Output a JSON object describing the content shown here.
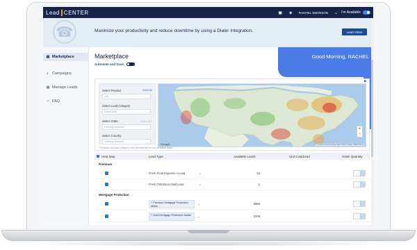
{
  "brand": {
    "logo_left": "Lead",
    "logo_right": "CENTER"
  },
  "topbar": {
    "user": "RACHEL SWANSON",
    "availability": "I'm Available"
  },
  "banner": {
    "message": "Maximize your productivity and reduce downtime by using a Dialer Integration.",
    "cta": "Learn More",
    "slide_count": 3,
    "active_slide": 3
  },
  "sidebar": {
    "items": [
      {
        "label": "Marketplace",
        "icon": "storefront-icon",
        "active": true
      },
      {
        "label": "Campaigns",
        "icon": "campaign-icon",
        "active": false
      },
      {
        "label": "Manage Leads",
        "icon": "leads-icon",
        "active": false
      },
      {
        "label": "FAQ",
        "icon": "faq-icon",
        "active": false
      }
    ]
  },
  "main": {
    "title": "Marketplace",
    "automate_label": "Automate and Save:",
    "greeting": "Good Morning, RACHEL"
  },
  "filters": {
    "product_label": "Select Product",
    "clear_all": "Clear All",
    "product_value": "Life",
    "category_label": "Select Lead Category",
    "category_value": "Direct Mail",
    "state_label": "Select State",
    "state_sub": "Select ALL",
    "state_value": "Nothing selected",
    "country_label": "Select Country",
    "country_value": "Nothing selected",
    "note": "* Product not Lead Category must be selected to see available leads"
  },
  "map": {
    "attribution": "Keyboard shortcuts   Map data ©2023 Google, INEGI   Terms",
    "zoom_in": "+",
    "zoom_out": "−",
    "google": "Google"
  },
  "table": {
    "headers": {
      "heatmap": "Heat Map",
      "lead_type": "Lead Type",
      "available": "Available Leads",
      "unit_cost": "Unit Cost/Lead",
      "order_qty": "Order Quantity"
    },
    "sections": [
      {
        "name": "Premium",
        "rows": [
          {
            "lead_type": "Fresh Final Expense A Lead",
            "available": "23"
          },
          {
            "lead_type": "Fresh T65 Direct Mail Lead",
            "available": "1"
          }
        ]
      },
      {
        "name": "Mortgage Protection",
        "rows": [
          {
            "lead_type": "Premium Mortgage Protection Mailer",
            "available": "3983"
          },
          {
            "lead_type": "Gold Mortgage Protection Mailer",
            "available": "2209"
          }
        ]
      }
    ]
  },
  "colors": {
    "navy": "#16244a",
    "accent_blue": "#4b7be6",
    "button_blue": "#1a4a9c",
    "gold": "#e6a532"
  }
}
